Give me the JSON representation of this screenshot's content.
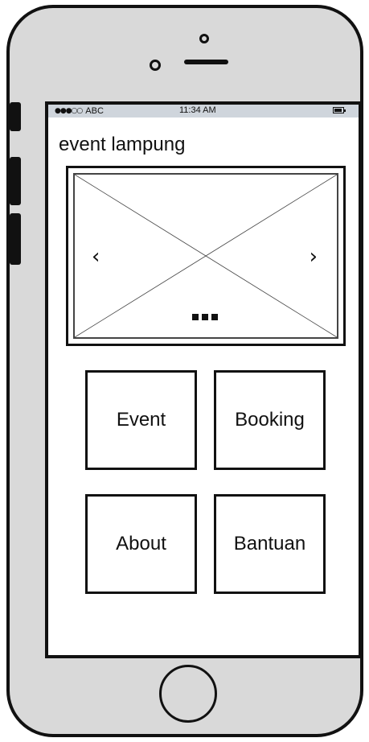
{
  "status_bar": {
    "signal": "●●●○○",
    "carrier": "ABC",
    "time": "11:34 AM",
    "battery_icon": "battery-icon"
  },
  "app": {
    "title": "event lampung"
  },
  "carousel": {
    "prev_icon": "‹",
    "next_icon": "›",
    "page_dots": 3
  },
  "menu": {
    "event_label": "Event",
    "booking_label": "Booking",
    "about_label": "About",
    "bantuan_label": "Bantuan"
  }
}
